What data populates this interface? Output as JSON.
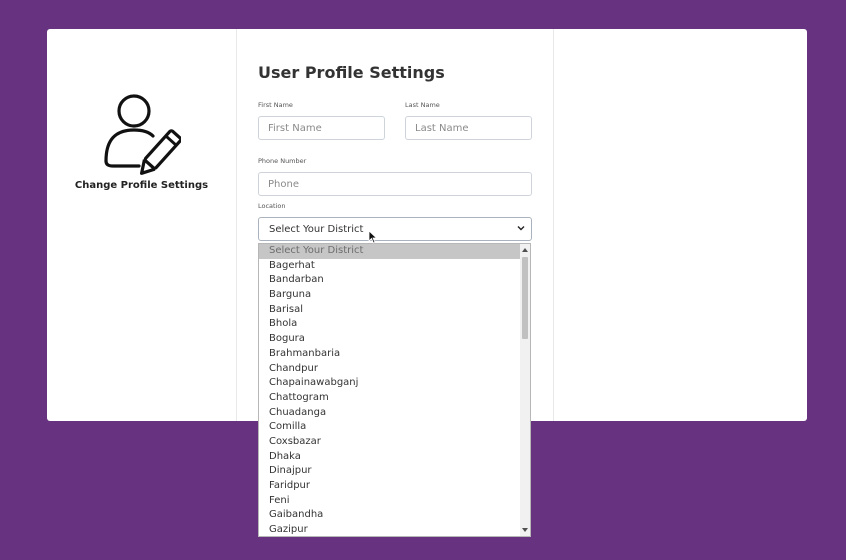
{
  "profile_panel": {
    "title": "Change Profile Settings",
    "icon": "user-edit-icon"
  },
  "form": {
    "title": "User Profile Settings",
    "first_name": {
      "label": "First Name",
      "placeholder": "First Name"
    },
    "last_name": {
      "label": "Last Name",
      "placeholder": "Last Name"
    },
    "phone": {
      "label": "Phone Number",
      "placeholder": "Phone"
    },
    "location": {
      "label": "Location",
      "selected": "Select Your District",
      "options": [
        "Select Your District",
        "Bagerhat",
        "Bandarban",
        "Barguna",
        "Barisal",
        "Bhola",
        "Bogura",
        "Brahmanbaria",
        "Chandpur",
        "Chapainawabganj",
        "Chattogram",
        "Chuadanga",
        "Comilla",
        "Coxsbazar",
        "Dhaka",
        "Dinajpur",
        "Faridpur",
        "Feni",
        "Gaibandha",
        "Gazipur"
      ]
    }
  },
  "colors": {
    "background": "#67327f",
    "card": "#ffffff",
    "selected_option": "#c6c6c6"
  }
}
